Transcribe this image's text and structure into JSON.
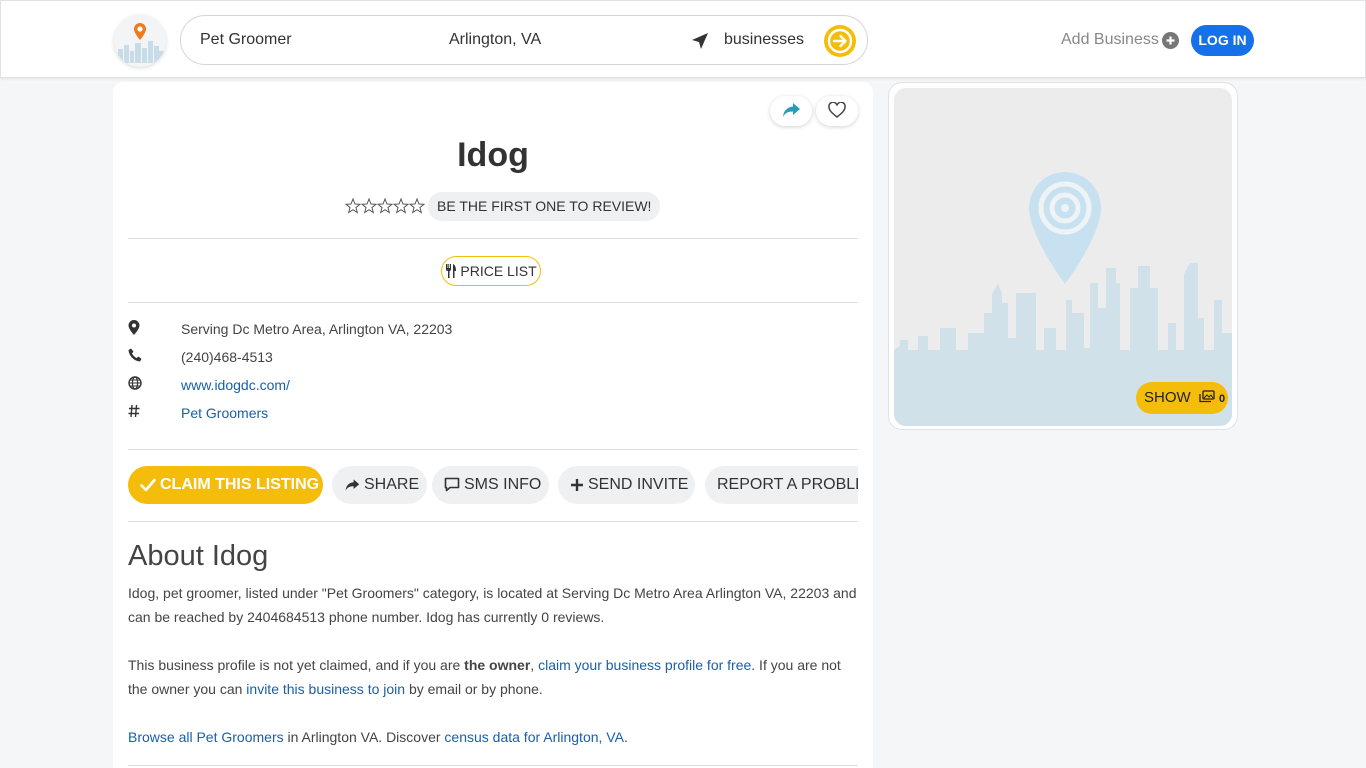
{
  "header": {
    "search_query": "Pet Groomer",
    "search_location": "Arlington, VA",
    "search_type": "businesses",
    "add_business_label": "Add Business",
    "login_label": "LOG IN"
  },
  "business": {
    "name": "Idog",
    "review_prompt": "BE THE FIRST ONE TO REVIEW!",
    "price_list_label": "PRICE LIST",
    "address": "Serving Dc Metro Area, Arlington VA, 22203",
    "phone": "(240)468-4513",
    "website": "www.idogdc.com/",
    "category": "Pet Groomers"
  },
  "actions": {
    "claim": "CLAIM THIS LISTING",
    "share": "SHARE",
    "sms": "SMS INFO",
    "invite": "SEND INVITE",
    "report": "REPORT A PROBLEM"
  },
  "about": {
    "heading": "About Idog",
    "p1": "Idog, pet groomer, listed under \"Pet Groomers\" category, is located at Serving Dc Metro Area Arlington VA, 22203 and can be reached by 2404684513 phone number. Idog has currently 0 reviews.",
    "p2_a": "This business profile is not yet claimed, and if you are ",
    "p2_bold": "the owner",
    "p2_b": ", ",
    "p2_link1": "claim your business profile for free",
    "p2_c": ". If you are not the owner you can ",
    "p2_link2": "invite this business to join",
    "p2_d": " by email or by phone.",
    "p3_link1": "Browse all Pet Groomers",
    "p3_a": " in Arlington VA. Discover ",
    "p3_link2": "census data for Arlington, VA",
    "p3_b": "."
  },
  "photos": {
    "show_label": "SHOW",
    "count": "0"
  },
  "colors": {
    "accent_yellow": "#f5bd0b",
    "primary_blue": "#1670ea",
    "link_blue": "#1a5fa8"
  }
}
